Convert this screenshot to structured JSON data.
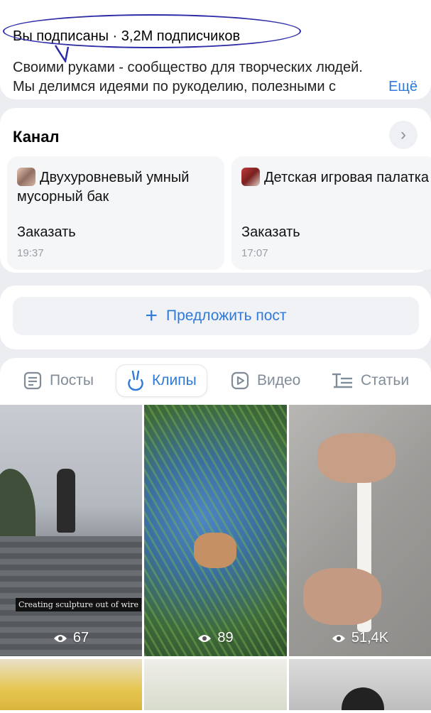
{
  "header": {
    "subscription_status": "Вы подписаны · 3,2М подписчиков",
    "description_line1": "Своими руками - сообщество для творческих людей.",
    "description_line2": "Мы делимся идеями по рукоделию, полезными с",
    "more_label": "Ещё"
  },
  "channel": {
    "title": "Канал",
    "posts": [
      {
        "title": "Двухуровневый умный мусорный бак",
        "action": "Заказать",
        "time": "19:37"
      },
      {
        "title": "Детская игровая палатка",
        "action": "Заказать",
        "time": "17:07"
      }
    ]
  },
  "suggest_post": {
    "label": "Предложить пост"
  },
  "tabs": [
    {
      "label": "Посты",
      "icon": "posts-icon",
      "active": false
    },
    {
      "label": "Клипы",
      "icon": "clips-icon",
      "active": true
    },
    {
      "label": "Видео",
      "icon": "video-icon",
      "active": false
    },
    {
      "label": "Статьи",
      "icon": "articles-icon",
      "active": false
    }
  ],
  "clips": [
    {
      "views": "67",
      "caption": "Creating sculpture out of wire"
    },
    {
      "views": "89"
    },
    {
      "views": "51,4K"
    }
  ],
  "colors": {
    "accent": "#2f7ad8",
    "annotation": "#2d2ba6",
    "background": "#ecedf0"
  }
}
